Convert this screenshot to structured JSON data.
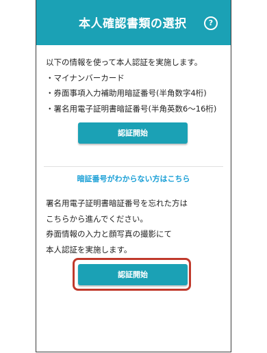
{
  "header": {
    "title": "本人確認書類の選択",
    "help_icon": "?"
  },
  "intro": {
    "lines": [
      "以下の情報を使って本人認証を実施します。",
      "・マイナンバーカード",
      "・券面事項入力補助用暗証番号(半角数字4桁)",
      "・署名用電子証明書暗証番号(半角英数6〜16桁)"
    ]
  },
  "primary_button": {
    "label": "認証開始"
  },
  "forgot_link": {
    "label": "暗証番号がわからない方はこちら"
  },
  "alt": {
    "lines": [
      "署名用電子証明書暗証番号を忘れた方は",
      "こちらから進んでください。",
      "券面情報の入力と顔写真の撮影にて",
      "本人認証を実施します。"
    ]
  },
  "secondary_button": {
    "label": "認証開始"
  },
  "colors": {
    "accent": "#1ba1b5",
    "link": "#1a9fd6",
    "highlight": "#c0392b"
  }
}
